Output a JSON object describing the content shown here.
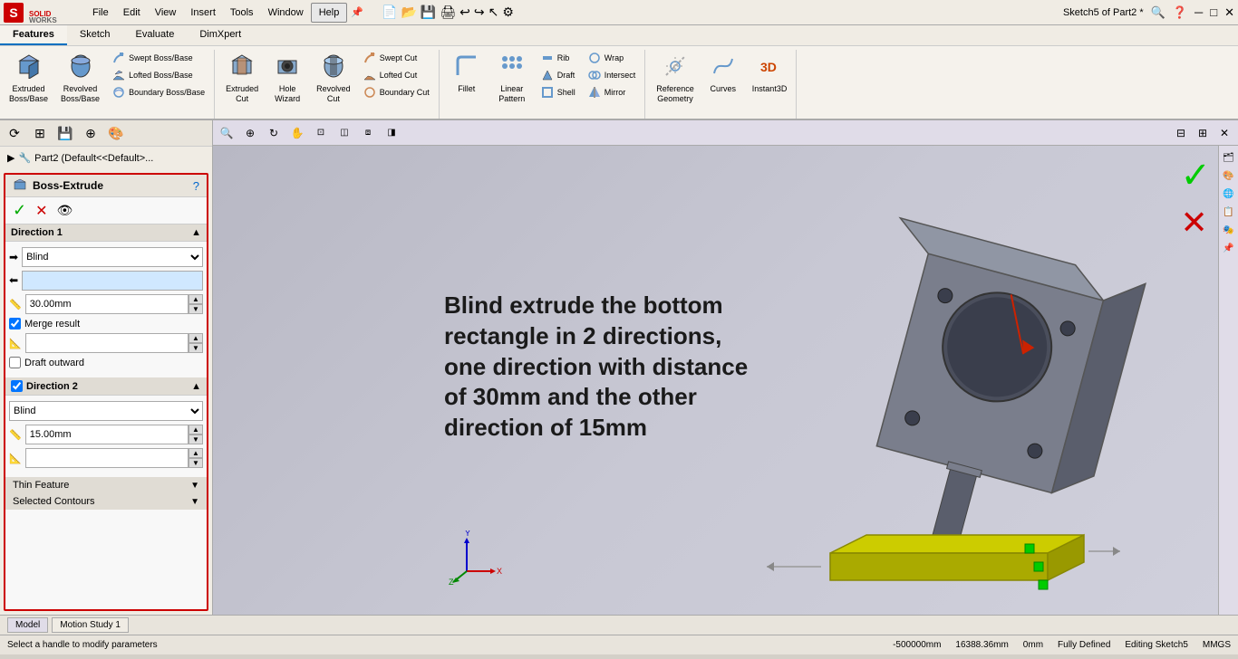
{
  "app": {
    "title": "Sketch5 of Part2 *",
    "logo_text": "SOLIDWORKS"
  },
  "menu": {
    "items": [
      "File",
      "Edit",
      "View",
      "Insert",
      "Tools",
      "Window",
      "Help"
    ]
  },
  "ribbon": {
    "tabs": [
      "Features",
      "Sketch",
      "Evaluate",
      "DimXpert"
    ],
    "active_tab": "Features",
    "groups": {
      "boss": {
        "extruded": "Extruded\nBoss/Base",
        "revolved": "Revolved\nBoss/Base",
        "lofted": "Lofted Boss/Base",
        "swept": "Swept Boss/Base",
        "boundary": "Boundary Boss/Base"
      },
      "cut": {
        "extruded_cut": "Extruded\nCut",
        "hole": "Hole\nWizard",
        "revolved_cut": "Revolved\nCut",
        "swept_cut": "Swept Cut",
        "lofted_cut": "Lofted Cut",
        "boundary_cut": "Boundary Cut"
      },
      "features": {
        "fillet": "Fillet",
        "linear_pattern": "Linear\nPattern",
        "draft": "Draft",
        "shell": "Shell",
        "rib": "Rib",
        "wrap": "Wrap",
        "intersect": "Intersect",
        "mirror": "Mirror"
      },
      "ref": {
        "reference_geometry": "Reference\nGeometry",
        "curves": "Curves",
        "instant3d": "Instant3D"
      }
    }
  },
  "panel": {
    "title": "Boss-Extrude",
    "direction1": {
      "label": "Direction 1",
      "type": "Blind",
      "distance": "30.00mm",
      "merge_result": true,
      "draft_outward": false
    },
    "direction2": {
      "label": "Direction 2",
      "type": "Blind",
      "distance": "15.00mm"
    },
    "thin_feature": {
      "label": "Thin Feature"
    },
    "selected_contours": {
      "label": "Selected Contours"
    }
  },
  "annotation": {
    "text": "Blind extrude the bottom rectangle in 2 directions, one direction with distance of 30mm and the other direction of 15mm"
  },
  "feature_tree": {
    "item": "Part2  (Default<<Default>..."
  },
  "status_bar": {
    "left": "Select a handle to modify parameters",
    "coords1": "-500000mm",
    "coords2": "16388.36mm",
    "coords3": "0mm",
    "status": "Fully Defined",
    "editing": "Editing Sketch5",
    "units": "MMGS"
  }
}
